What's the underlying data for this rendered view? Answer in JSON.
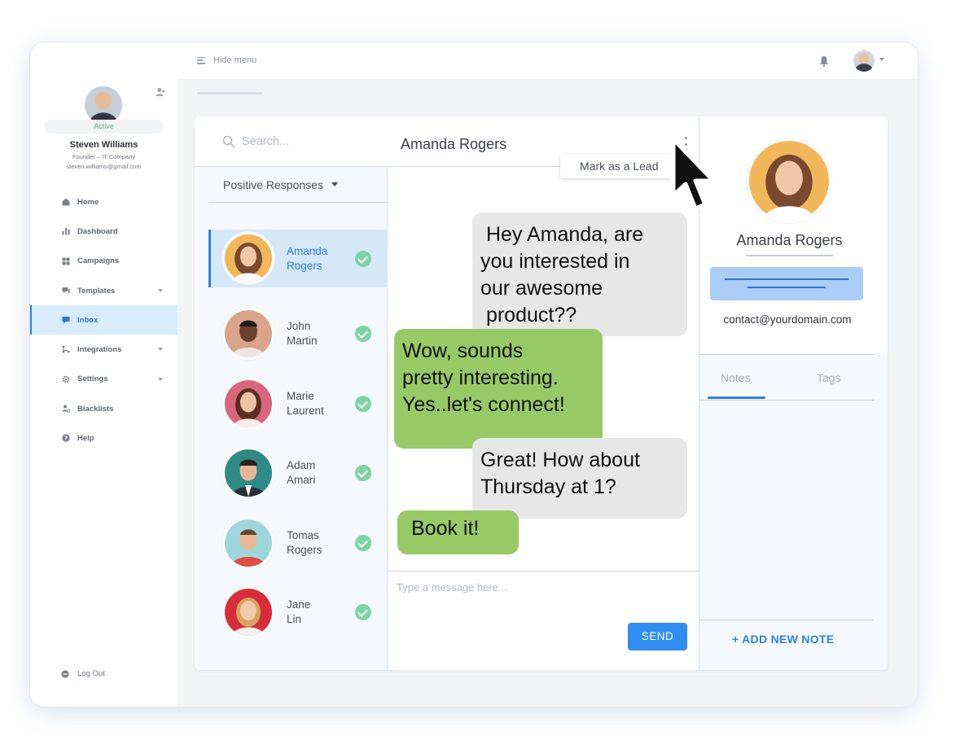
{
  "topbar": {
    "hide_menu_label": "Hide menu"
  },
  "profile": {
    "status": "Active",
    "name": "Steven Williams",
    "role": "Founder – IT Company",
    "email": "steven.williams@gmail.com"
  },
  "nav": {
    "items": [
      {
        "label": "Home",
        "icon": "home-icon"
      },
      {
        "label": "Dashboard",
        "icon": "bar-chart-icon"
      },
      {
        "label": "Campaigns",
        "icon": "grid-icon"
      },
      {
        "label": "Templates",
        "icon": "chat-bubbles-icon"
      },
      {
        "label": "Inbox",
        "icon": "message-icon"
      },
      {
        "label": "Integrations",
        "icon": "flow-icon"
      },
      {
        "label": "Settings",
        "icon": "gear-icon"
      },
      {
        "label": "Blacklists",
        "icon": "people-block-icon"
      },
      {
        "label": "Help",
        "icon": "question-icon"
      }
    ],
    "logout_label": "Log Out"
  },
  "inbox": {
    "search_placeholder": "Search...",
    "filter_label": "Positive Responses",
    "contacts": [
      {
        "first": "Amanda",
        "last": "Rogers"
      },
      {
        "first": "John",
        "last": "Martin"
      },
      {
        "first": "Marie",
        "last": "Laurent"
      },
      {
        "first": "Adam",
        "last": "Amari"
      },
      {
        "first": "Tomas",
        "last": "Rogers"
      },
      {
        "first": "Jane",
        "last": "Lin"
      }
    ]
  },
  "chat": {
    "title": "Amanda Rogers",
    "menu_item": "Mark as a Lead",
    "messages": [
      {
        "side": "out",
        "lines": [
          " Hey Amanda, are",
          "you interested in",
          "our awesome",
          " product??"
        ]
      },
      {
        "side": "in",
        "lines": [
          "Wow, sounds",
          "pretty interesting.",
          "Yes..let's connect!"
        ]
      },
      {
        "side": "out",
        "lines": [
          "Great! How about",
          "Thursday at 1?"
        ]
      },
      {
        "side": "in",
        "lines": [
          "Book it!"
        ]
      }
    ],
    "composer_placeholder": "Type a message here...",
    "send_label": "SEND"
  },
  "contact_info": {
    "name": "Amanda Rogers",
    "email": "contact@yourdomain.com",
    "tabs": [
      "Notes",
      "Tags"
    ],
    "add_note_label": "+ ADD NEW NOTE"
  },
  "colors": {
    "accent": "#2f80e0",
    "incoming_bubble": "#97c966",
    "outgoing_bubble": "#e7e7e7",
    "check": "#7ed3a5"
  }
}
